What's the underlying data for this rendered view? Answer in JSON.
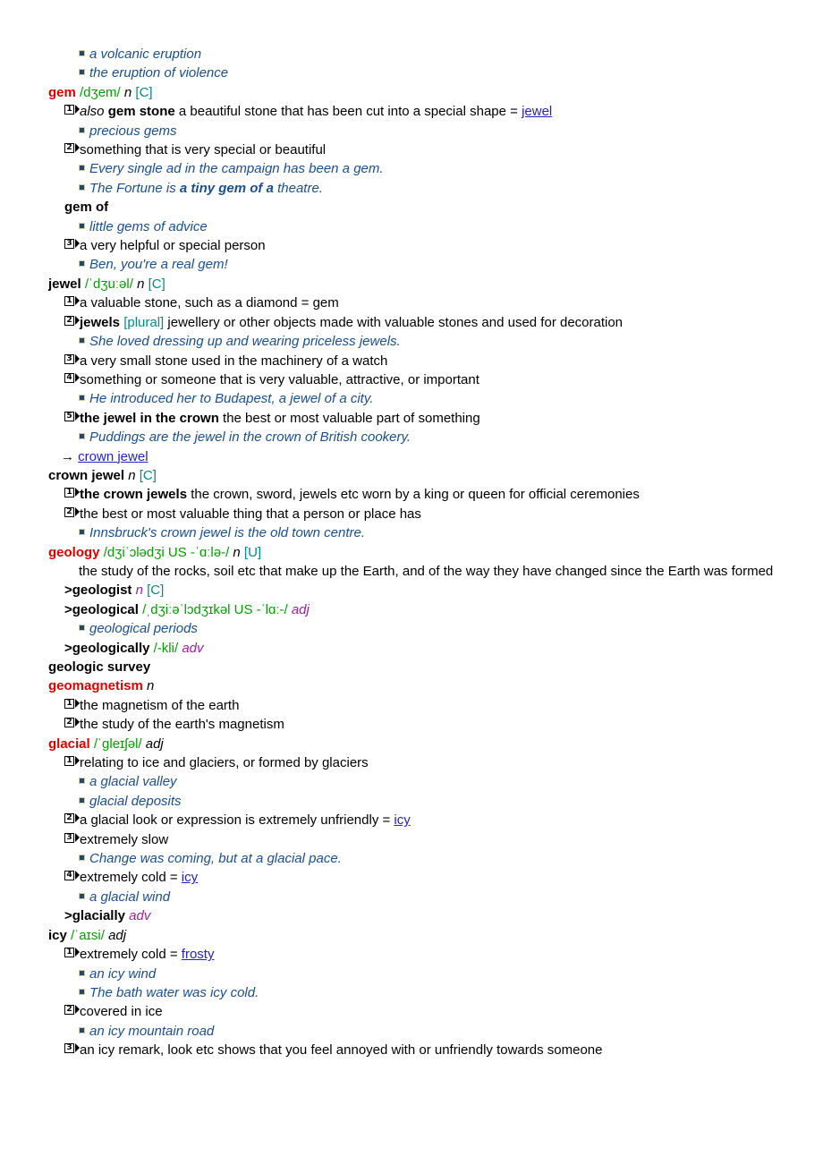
{
  "colors": {
    "headword_main": "#e00000",
    "headword_sub": "#000000",
    "phonetic": "#00a000",
    "grammar_label": "#008b8b",
    "pos_derived": "#a020a0",
    "example": "#1a4f8f",
    "cross_reference_link": "#2222cc",
    "bullet": "#23457c"
  },
  "entries": [
    {
      "id": "eruption-tail",
      "examples_top": [
        "a volcanic eruption",
        "the eruption of violence"
      ]
    },
    {
      "id": "gem",
      "headword": "gem",
      "phonetic": "/dʒem/",
      "pos": "n",
      "gram": "[C]",
      "senses": [
        {
          "num": "1",
          "pre_italic": "also",
          "pre_bold": "gem stone",
          "text": " a beautiful stone that has been cut into a special shape = ",
          "link": "jewel",
          "examples": [
            "precious gems"
          ]
        },
        {
          "num": "2",
          "text": "something that is very special or beautiful",
          "examples": [
            "Every single ad in the campaign has been a gem.",
            "The Fortune is a tiny gem of a theatre."
          ]
        },
        {
          "num": "3",
          "text": "a very helpful or special person",
          "examples": [
            "Ben, you're a real gem!"
          ]
        }
      ],
      "phrase": {
        "label": "gem of",
        "examples": [
          "little gems of advice"
        ]
      }
    },
    {
      "id": "jewel",
      "headword": "jewel",
      "phonetic": "/ˈdʒuːəl/",
      "pos": "n",
      "gram": "[C]",
      "senses": [
        {
          "num": "1",
          "text": "a valuable stone, such as a diamond = gem"
        },
        {
          "num": "2",
          "pre_bold": "jewels",
          "label": "[plural]",
          "text": " jewellery or other objects made with valuable stones and used for decoration",
          "examples": [
            "She loved dressing up and wearing priceless jewels."
          ]
        },
        {
          "num": "3",
          "text": "a very small stone used in the machinery of a watch"
        },
        {
          "num": "4",
          "text": "something or someone that is very valuable, attractive, or important",
          "examples": [
            "He introduced her to Budapest, a jewel of a city."
          ]
        },
        {
          "num": "5",
          "pre_bold": "the jewel in the crown",
          "text": " the best or most valuable part of something",
          "examples": [
            "Puddings are the jewel in the crown of British cookery."
          ]
        }
      ],
      "xref": {
        "arrow": "→",
        "link": "crown jewel"
      }
    },
    {
      "id": "crown-jewel",
      "headword": "crown jewel",
      "pos": "n",
      "gram": "[C]",
      "senses": [
        {
          "num": "1",
          "pre_bold": "the crown jewels",
          "text": " the crown, sword, jewels etc worn by a king or queen for official ceremonies"
        },
        {
          "num": "2",
          "text": "the best or most valuable thing that a person or place has",
          "examples": [
            "Innsbruck's crown jewel is the old town centre."
          ]
        }
      ]
    },
    {
      "id": "geology",
      "headword": "geology",
      "phonetic": "/dʒiˈɔlədʒi US -ˈɑːlə-/",
      "pos": "n",
      "gram": "[U]",
      "definition": "the study of the rocks, soil etc that make up the Earth, and of the way they have changed since the Earth was formed",
      "derived": [
        {
          "marker": ">",
          "word": "geologist",
          "pos": "n",
          "gram": "[C]"
        },
        {
          "marker": ">",
          "word": "geological",
          "phonetic": "/ˌdʒiːəˈlɔdʒɪkəl US -ˈlɑː-/",
          "pos": "adj",
          "examples": [
            "geological periods"
          ]
        },
        {
          "marker": ">",
          "word": "geologically",
          "phonetic": "/-kli/",
          "pos": "adv"
        }
      ]
    },
    {
      "id": "geologic-survey",
      "headword": "geologic survey",
      "headword_style": "sub"
    },
    {
      "id": "geomagnetism",
      "headword": "geomagnetism",
      "pos": "n",
      "senses": [
        {
          "num": "1",
          "text": "the magnetism of the earth"
        },
        {
          "num": "2",
          "text": "the study of the earth's magnetism"
        }
      ]
    },
    {
      "id": "glacial",
      "headword": "glacial",
      "phonetic": "/ˈgleɪʃəl/",
      "pos": "adj",
      "senses": [
        {
          "num": "1",
          "text": "relating to ice and glaciers, or formed by glaciers",
          "examples": [
            "a glacial valley",
            "glacial deposits"
          ]
        },
        {
          "num": "2",
          "text": "a glacial look or expression is extremely unfriendly = ",
          "link": "icy"
        },
        {
          "num": "3",
          "text": "extremely slow",
          "examples": [
            "Change was coming, but at a glacial pace."
          ]
        },
        {
          "num": "4",
          "text": "extremely cold = ",
          "link": "icy",
          "examples": [
            "a glacial wind"
          ]
        }
      ],
      "derived": [
        {
          "marker": ">",
          "word": "glacially",
          "pos": "adv"
        }
      ]
    },
    {
      "id": "icy",
      "headword": "icy",
      "headword_style": "sub",
      "phonetic": "/ˈaɪsi/",
      "pos": "adj",
      "senses": [
        {
          "num": "1",
          "text": "extremely cold = ",
          "link": "frosty",
          "examples": [
            "an icy wind",
            "The bath water was icy cold."
          ]
        },
        {
          "num": "2",
          "text": "covered in ice",
          "examples": [
            "an icy mountain road"
          ]
        },
        {
          "num": "3",
          "text": "an icy remark, look etc shows that you feel annoyed with or unfriendly towards someone"
        }
      ]
    }
  ]
}
